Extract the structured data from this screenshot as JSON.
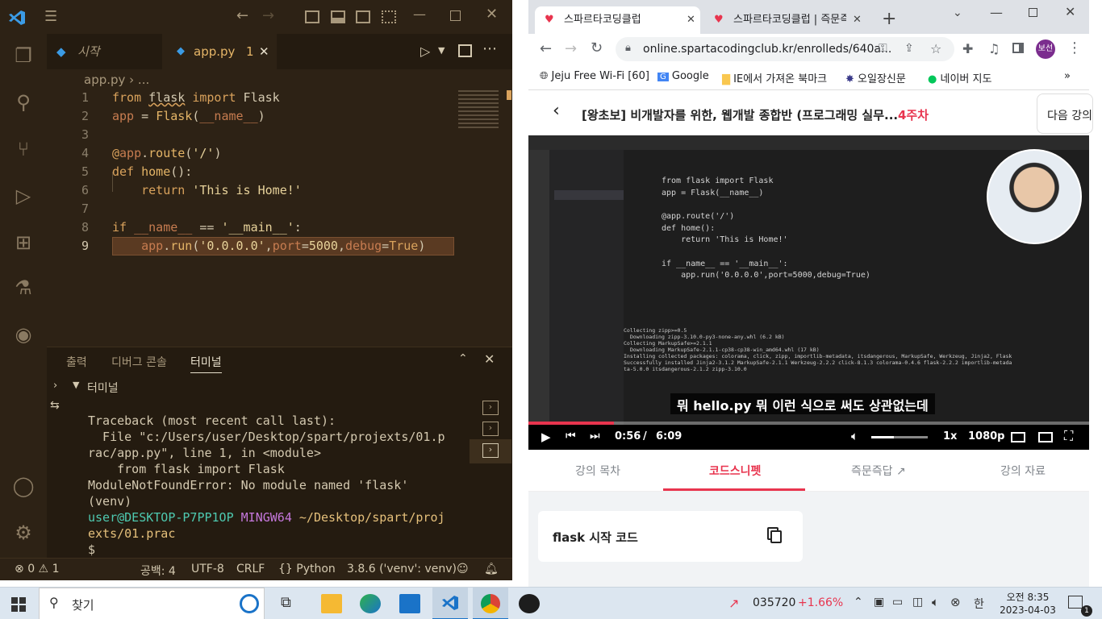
{
  "vscode": {
    "tabs": [
      {
        "label": "시작"
      },
      {
        "label": "app.py",
        "problems": "1"
      }
    ],
    "breadcrumb": "app.py › ...",
    "code_lines": [
      {
        "n": "1",
        "text": "from flask import Flask"
      },
      {
        "n": "2",
        "text": "app = Flask(__name__)"
      },
      {
        "n": "3",
        "text": ""
      },
      {
        "n": "4",
        "text": "@app.route('/')"
      },
      {
        "n": "5",
        "text": "def home():"
      },
      {
        "n": "6",
        "text": "    return 'This is Home!'"
      },
      {
        "n": "7",
        "text": ""
      },
      {
        "n": "8",
        "text": "if __name__ == '__main__':"
      },
      {
        "n": "9",
        "text": "    app.run('0.0.0.0',port=5000,debug=True)"
      }
    ],
    "panel_tabs": [
      "출력",
      "디버그 콘솔",
      "터미널"
    ],
    "terminal_header": "터미널",
    "terminal_lines": [
      "Traceback (most recent call last):",
      "  File \"c:/Users/user/Desktop/spart/projexts/01.p",
      "rac/app.py\", line 1, in <module>",
      "    from flask import Flask",
      "ModuleNotFoundError: No module named 'flask'",
      "(venv)"
    ],
    "prompt_user": "user@DESKTOP-P7PP1OP",
    "prompt_shell": "MINGW64",
    "prompt_path1": "~/Desktop/spart/proj",
    "prompt_path2": "exts/01.prac",
    "prompt_symbol": "$",
    "status": {
      "errors": "0",
      "warnings": "1",
      "spaces": "공백: 4",
      "encoding": "UTF-8",
      "eol": "CRLF",
      "language": "Python",
      "interpreter": "3.8.6 ('venv': venv)"
    }
  },
  "chrome": {
    "tabs": [
      "스파르타코딩클럽",
      "스파르타코딩클럽 | 즉문즉"
    ],
    "url": "online.spartacodingclub.kr/enrolleds/640a...",
    "profile": "보선",
    "bookmarks": [
      "Jeju Free Wi-Fi [60]",
      "Google",
      "IE에서 가져온 북마크",
      "오일장신문",
      "네이버 지도"
    ],
    "course_title": "[왕초보] 비개발자를 위한, 웹개발 종합반 (프로그래밍 실무...",
    "week": "4주차",
    "next_button": "다음 강의",
    "video": {
      "subtitle": "뭐 hello.py 뭐 이런 식으로 써도 상관없는데",
      "time_current": "0:56",
      "time_total": "6:09",
      "speed": "1x",
      "quality": "1080p",
      "progress": 0.152,
      "inner_code": [
        "from flask import Flask",
        "app = Flask(__name__)",
        "",
        "@app.route('/')",
        "def home():",
        "    return 'This is Home!'",
        "",
        "if __name__ == '__main__':",
        "    app.run('0.0.0.0',port=5000,debug=True)"
      ],
      "inner_terminal": [
        "Collecting zipp>=0.5",
        "  Downloading zipp-3.10.0-py3-none-any.whl (6.2 kB)",
        "Collecting MarkupSafe>=2.1.1",
        "  Downloading MarkupSafe-2.1.1-cp38-cp38-win_amd64.whl (17 kB)",
        "Installing collected packages: colorama, click, zipp, importlib-metadata, itsdangerous, MarkupSafe, Werkzeug, Jinja2, Flask",
        "Successfully installed Jinja2-3.1.2 MarkupSafe-2.1.1 Werkzeug-2.2.2 click-8.1.3 colorama-0.4.6 flask-2.2.2 importlib-metada",
        "ta-5.0.0 itsdangerous-2.1.2 zipp-3.10.0"
      ]
    },
    "lecture_tabs": [
      "강의 목차",
      "코드스니펫",
      "즉문즉답",
      "강의 자료"
    ],
    "snippet_title": "flask 시작 코드"
  },
  "taskbar": {
    "search": "찾기",
    "stock_code": "035720",
    "stock_change": "+1.66%",
    "ime": "한",
    "time": "오전 8:35",
    "date": "2023-04-03",
    "notifications": "1"
  },
  "colors": {
    "accent_red": "#e8344e",
    "vscode_bg": "#2d2215",
    "terminal_green": "#4ec9b0",
    "stock_red": "#e8344e"
  }
}
